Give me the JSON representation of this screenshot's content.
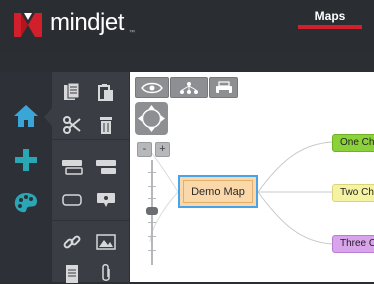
{
  "app": {
    "brand": "mindjet",
    "brand_mark": "™",
    "active_tab": "Maps"
  },
  "colors": {
    "background_dark": "#2a2d32",
    "panel": "#3a3d43",
    "accent_red": "#d11f2b",
    "nav_active_blue": "#3aa6d8",
    "nav_plus_teal": "#2aa7b5",
    "central_topic_fill": "#fbd8a9",
    "selection_blue": "#4aa3e8",
    "child_one": "#8bd23a",
    "child_two": "#f5f3a2",
    "child_three": "#d9a4ec"
  },
  "left_nav": [
    {
      "icon": "home-icon",
      "active": true
    },
    {
      "icon": "plus-icon",
      "active": false
    },
    {
      "icon": "palette-icon",
      "active": false
    }
  ],
  "tools": [
    "copy-icon",
    "paste-icon",
    "cut-icon",
    "trash-icon",
    "add-subtopic-icon",
    "add-topic-icon",
    "topic-shape-icon",
    "callout-icon",
    "link-icon",
    "image-icon",
    "notes-icon",
    "attachment-icon"
  ],
  "canvas_toolbar": [
    "eye-icon",
    "layout-icon",
    "print-icon"
  ],
  "zoom": {
    "minus": "-",
    "plus": "+",
    "level": 0.5
  },
  "map": {
    "central_topic": "Demo Map",
    "children": [
      "One Child",
      "Two Child",
      "Three Ch"
    ]
  }
}
